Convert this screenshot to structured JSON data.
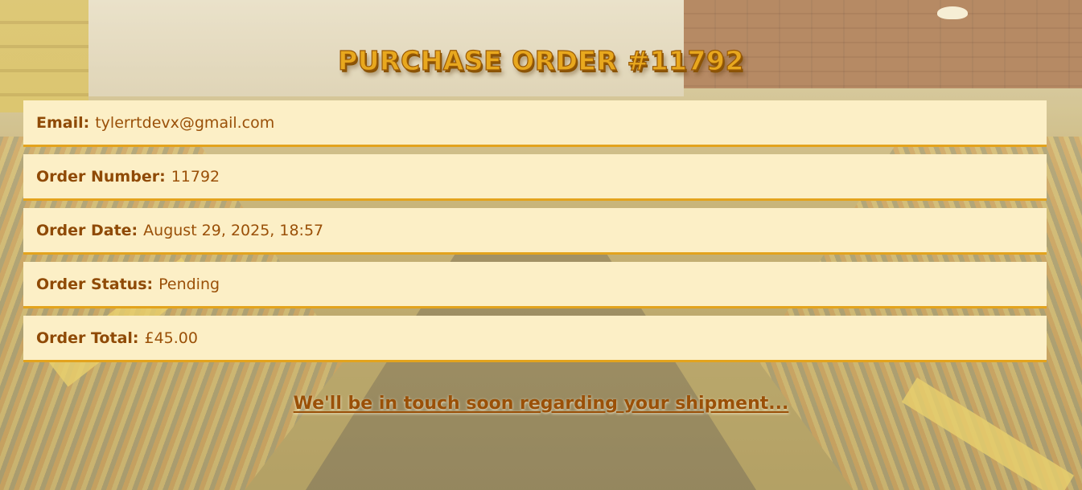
{
  "page": {
    "title": "Purchase Order #11792"
  },
  "order": {
    "rows": [
      {
        "label": "Email:",
        "value": "tylerrtdevx@gmail.com"
      },
      {
        "label": "Order Number:",
        "value": "11792"
      },
      {
        "label": "Order Date:",
        "value": "August 29, 2025, 18:57"
      },
      {
        "label": "Order Status:",
        "value": "Pending"
      },
      {
        "label": "Order Total:",
        "value": "£45.00"
      }
    ]
  },
  "footer": {
    "message": "We'll be in touch soon regarding your shipment..."
  },
  "colors": {
    "row_background": "#fcefc6",
    "row_border": "#e3a31d",
    "text": "#9a5008",
    "title": "#e8a81e"
  }
}
